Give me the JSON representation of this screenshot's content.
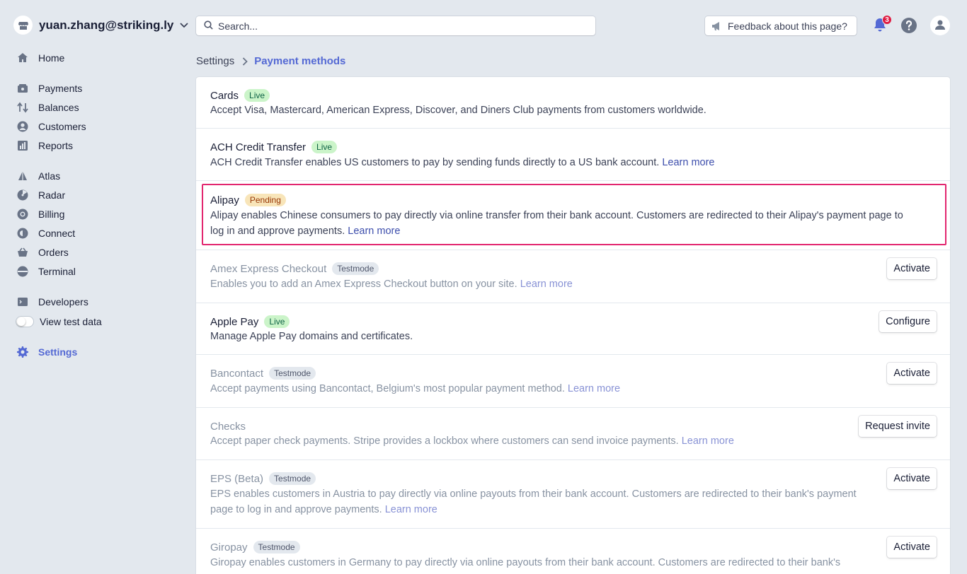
{
  "account": {
    "name": "yuan.zhang@striking.ly"
  },
  "nav": {
    "home": "Home",
    "payments": "Payments",
    "balances": "Balances",
    "customers": "Customers",
    "reports": "Reports",
    "atlas": "Atlas",
    "radar": "Radar",
    "billing": "Billing",
    "connect": "Connect",
    "orders": "Orders",
    "terminal": "Terminal",
    "developers": "Developers",
    "view_test_data": "View test data",
    "settings": "Settings"
  },
  "search": {
    "placeholder": "Search..."
  },
  "feedback": {
    "label": "Feedback about this page?"
  },
  "notifications": {
    "count": "3"
  },
  "breadcrumb": {
    "root": "Settings",
    "current": "Payment methods"
  },
  "colors": {
    "accent": "#5469d4",
    "highlight": "#e2266f",
    "live": "#cbf4c9",
    "pending": "#f8e5b9"
  },
  "methods": [
    {
      "name": "Cards",
      "status": "Live",
      "desc": "Accept Visa, Mastercard, American Express, Discover, and Diners Club payments from customers worldwide.",
      "link": "",
      "action": ""
    },
    {
      "name": "ACH Credit Transfer",
      "status": "Live",
      "desc": "ACH Credit Transfer enables US customers to pay by sending funds directly to a US bank account.",
      "link": "Learn more",
      "action": ""
    },
    {
      "name": "Alipay",
      "status": "Pending",
      "desc": "Alipay enables Chinese consumers to pay directly via online transfer from their bank account. Customers are redirected to their Alipay's payment page to log in and approve payments.",
      "link": "Learn more",
      "action": ""
    },
    {
      "name": "Amex Express Checkout",
      "status": "Testmode",
      "desc": "Enables you to add an Amex Express Checkout button on your site.",
      "link": "Learn more",
      "action": "Activate"
    },
    {
      "name": "Apple Pay",
      "status": "Live",
      "desc": "Manage Apple Pay domains and certificates.",
      "link": "",
      "action": "Configure"
    },
    {
      "name": "Bancontact",
      "status": "Testmode",
      "desc": "Accept payments using Bancontact, Belgium's most popular payment method.",
      "link": "Learn more",
      "action": "Activate"
    },
    {
      "name": "Checks",
      "status": "",
      "desc": "Accept paper check payments. Stripe provides a lockbox where customers can send invoice payments.",
      "link": "Learn more",
      "action": "Request invite"
    },
    {
      "name": "EPS (Beta)",
      "status": "Testmode",
      "desc": "EPS enables customers in Austria to pay directly via online payouts from their bank account. Customers are redirected to their bank's payment page to log in and approve payments.",
      "link": "Learn more",
      "action": "Activate"
    },
    {
      "name": "Giropay",
      "status": "Testmode",
      "desc": "Giropay enables customers in Germany to pay directly via online payouts from their bank account. Customers are redirected to their bank's",
      "link": "",
      "action": "Activate"
    }
  ]
}
